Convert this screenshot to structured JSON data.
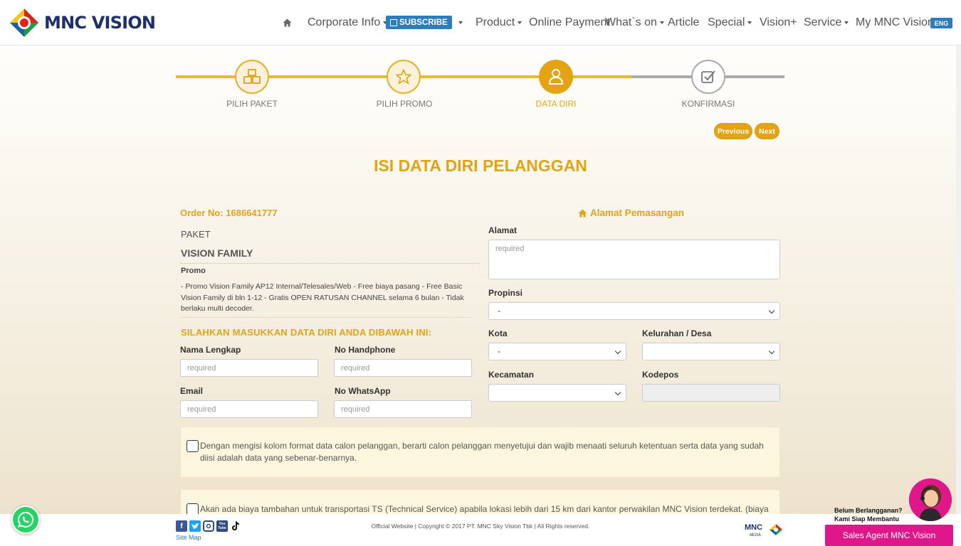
{
  "brand": {
    "name": "MNC VISION",
    "logo_colors": [
      "#e2231a",
      "#f5c518",
      "#1a9e48",
      "#1e5fa8"
    ]
  },
  "nav": {
    "home_icon": "home-icon",
    "items": [
      {
        "label": "Corporate Info",
        "dropdown": true
      },
      {
        "label": "SUBSCRIBE",
        "dropdown": true
      },
      {
        "label": "Product",
        "dropdown": true
      },
      {
        "label": "Online Payment",
        "dropdown": false
      },
      {
        "label": "What`s on",
        "dropdown": true
      },
      {
        "label": "Article",
        "dropdown": false
      },
      {
        "label": "Special",
        "dropdown": true
      },
      {
        "label": "Vision+",
        "dropdown": false
      },
      {
        "label": "Service",
        "dropdown": true
      },
      {
        "label": "My MNC Vision",
        "dropdown": false
      }
    ],
    "language": "ENG"
  },
  "stepper": {
    "steps": [
      {
        "label": "PILIH PAKET",
        "state": "done",
        "icon": "cubes-icon"
      },
      {
        "label": "PILIH PROMO",
        "state": "done",
        "icon": "star-icon"
      },
      {
        "label": "DATA DIRI",
        "state": "active",
        "icon": "user-icon"
      },
      {
        "label": "KONFIRMASI",
        "state": "todo",
        "icon": "check-square-icon"
      }
    ],
    "previous_label": "Previous",
    "next_label": "Next"
  },
  "page_title": "ISI DATA DIRI PELANGGAN",
  "order": {
    "order_no": "Order No: 1686641777",
    "paket_label": "PAKET",
    "paket_name": "VISION FAMILY",
    "promo_label": "Promo",
    "promo_desc": "- Promo Vision Family AP12 Internal/Telesales/Web - Free biaya pasang - Free Basic Vision Family di bln 1-12 - Gratis OPEN RATUSAN CHANNEL selama 6 bulan - Tidak berlaku multi decoder."
  },
  "form": {
    "instruction": "SILAHKAN MASUKKAN DATA DIRI ANDA DIBAWAH INI:",
    "nama_label": "Nama Lengkap",
    "handphone_label": "No Handphone",
    "email_label": "Email",
    "whatsapp_label": "No WhatsApp",
    "placeholder": "required"
  },
  "address": {
    "title": "Alamat Pemasangan",
    "alamat_label": "Alamat",
    "alamat_placeholder": "required",
    "propinsi_label": "Propinsi",
    "propinsi_value": "-",
    "kota_label": "Kota",
    "kota_value": "-",
    "kelurahan_label": "Kelurahan / Desa",
    "kelurahan_value": "",
    "kecamatan_label": "Kecamatan",
    "kecamatan_value": "",
    "kodepos_label": "Kodepos",
    "kodepos_value": ""
  },
  "consent": {
    "agreement_text": "Dengan mengisi kolom format data calon pelanggan, berarti calon pelanggan menyetujui dan wajib menaati seluruh ketentuan serta data yang sudah diisi adalah data yang sebenar-benarnya.",
    "transport_text": "Akan ada biaya tambahan untuk transportasi TS (Technical Service) apabila lokasi lebih dari 15 km dari kantor perwakilan MNC Vision terdekat. (biaya"
  },
  "footer": {
    "social_icons": [
      "facebook-icon",
      "twitter-icon",
      "instagram-icon",
      "youtube-icon",
      "tiktok-icon"
    ],
    "youtube_text": "You Tube",
    "site_map": "Site Map",
    "copyright": "Official Website | Copyright © 2017 PT. MNC Sky Vision Tbk | All Rights reserved.",
    "mnc_media": "MNC",
    "mnc_media_sub": "MEDIA"
  },
  "agent": {
    "line1": "Belum Berlangganan?",
    "line2": "Kami Siap Membantu",
    "button": "Sales Agent MNC Vision"
  },
  "colors": {
    "accent": "#e3a313",
    "nav_blue": "#2c7cc0",
    "agent_pink": "#e0178a",
    "whatsapp_green": "#25d366"
  }
}
